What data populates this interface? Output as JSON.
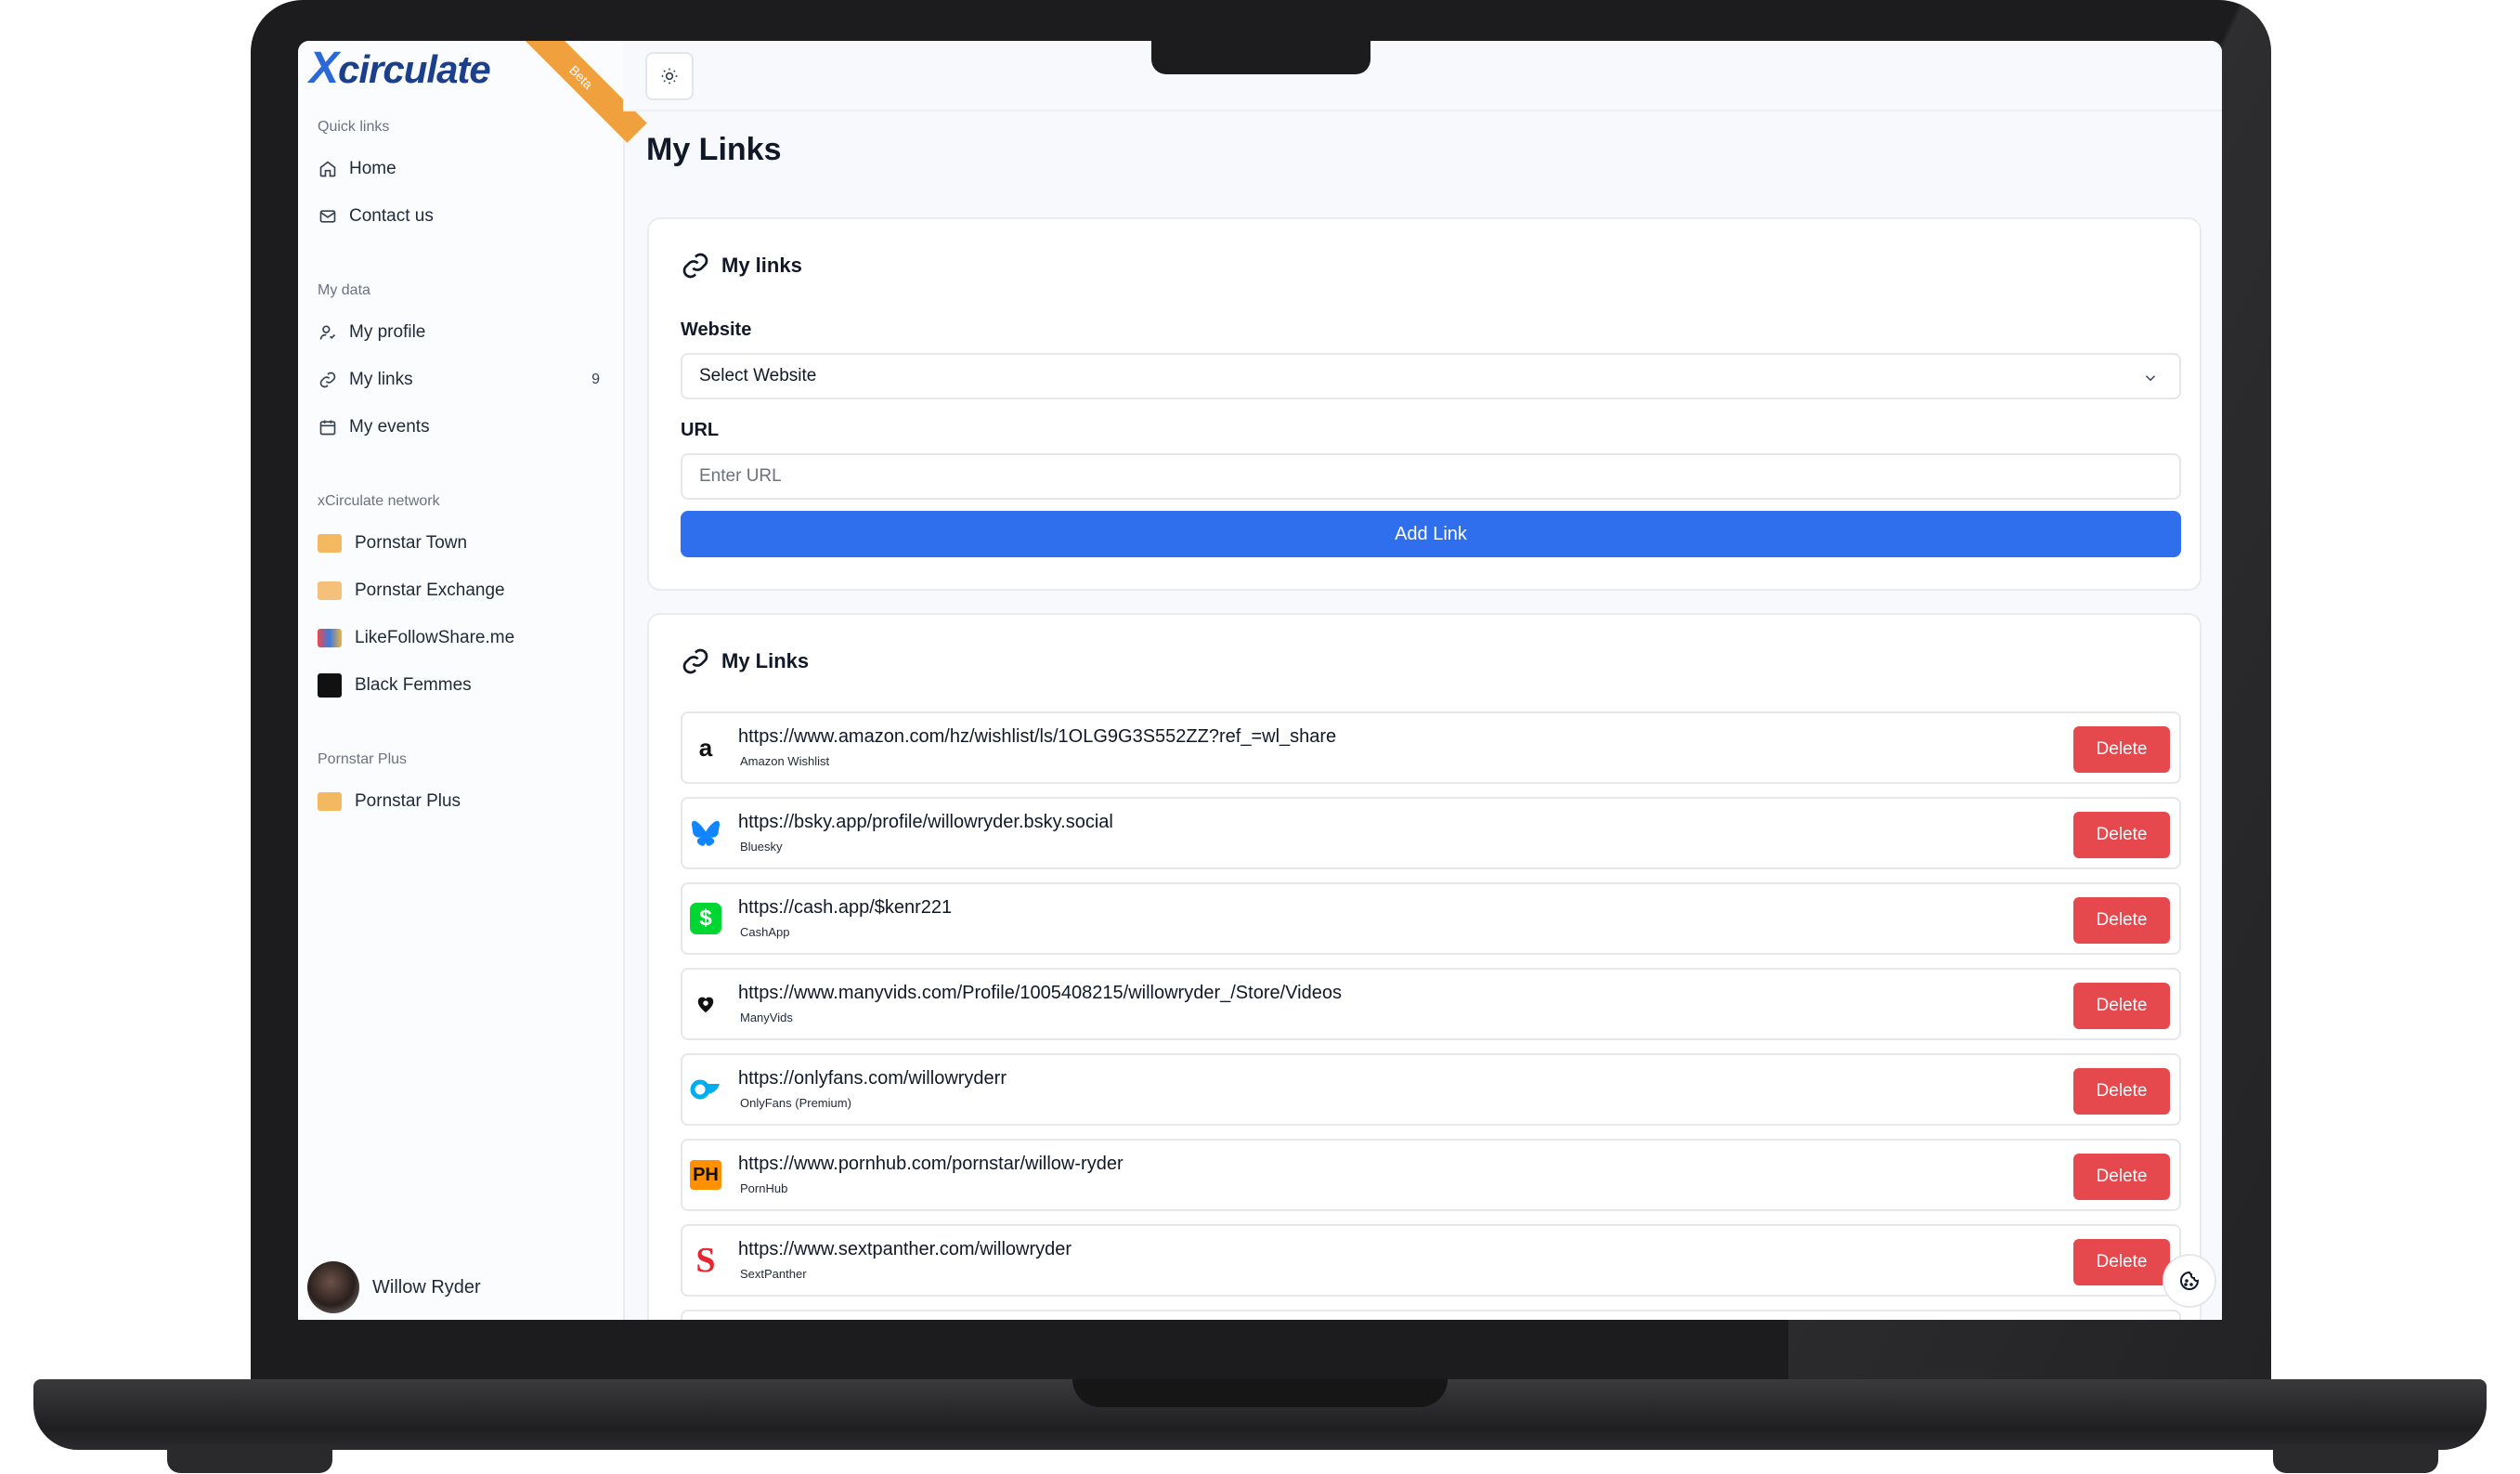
{
  "app": {
    "logo_x": "X",
    "logo_rest": "circulate",
    "beta": "Beta"
  },
  "sidebar": {
    "quick_links_label": "Quick links",
    "quick_links": [
      {
        "label": "Home",
        "icon": "home-icon"
      },
      {
        "label": "Contact us",
        "icon": "mail-icon"
      }
    ],
    "my_data_label": "My data",
    "my_data": [
      {
        "label": "My profile",
        "icon": "user-icon"
      },
      {
        "label": "My links",
        "icon": "link-icon",
        "count": "9"
      },
      {
        "label": "My events",
        "icon": "calendar-icon"
      }
    ],
    "network_label": "xCirculate network",
    "network": [
      {
        "label": "Pornstar Town",
        "icon": "pornstar-town-logo"
      },
      {
        "label": "Pornstar Exchange",
        "icon": "pornstar-exchange-logo"
      },
      {
        "label": "LikeFollowShare.me",
        "icon": "likefollowshare-logo"
      },
      {
        "label": "Black Femmes",
        "icon": "black-femmes-logo"
      }
    ],
    "plus_label": "Pornstar Plus",
    "plus": [
      {
        "label": "Pornstar Plus",
        "icon": "pornstar-plus-logo"
      }
    ],
    "user_name": "Willow Ryder"
  },
  "main": {
    "title": "My Links",
    "form": {
      "title": "My links",
      "website_label": "Website",
      "website_value": "Select Website",
      "url_label": "URL",
      "url_placeholder": "Enter URL",
      "add_button": "Add Link"
    },
    "list": {
      "title": "My Links",
      "delete_label": "Delete",
      "items": [
        {
          "url": "https://www.amazon.com/hz/wishlist/ls/1OLG9G3S552ZZ?ref_=wl_share",
          "site": "Amazon Wishlist",
          "icon": "amazon-icon"
        },
        {
          "url": "https://bsky.app/profile/willowryder.bsky.social",
          "site": "Bluesky",
          "icon": "bluesky-butterfly-icon"
        },
        {
          "url": "https://cash.app/$kenr221",
          "site": "CashApp",
          "icon": "cashapp-icon"
        },
        {
          "url": "https://www.manyvids.com/Profile/1005408215/willowryder_/Store/Videos",
          "site": "ManyVids",
          "icon": "manyvids-icon"
        },
        {
          "url": "https://onlyfans.com/willowryderr",
          "site": "OnlyFans (Premium)",
          "icon": "onlyfans-icon"
        },
        {
          "url": "https://www.pornhub.com/pornstar/willow-ryder",
          "site": "PornHub",
          "icon": "pornhub-icon"
        },
        {
          "url": "https://www.sextpanther.com/willowryder",
          "site": "SextPanther",
          "icon": "sextpanther-icon"
        }
      ]
    }
  },
  "colors": {
    "primary": "#2f6fed",
    "danger": "#e5484d",
    "beta": "#f0a03c"
  }
}
